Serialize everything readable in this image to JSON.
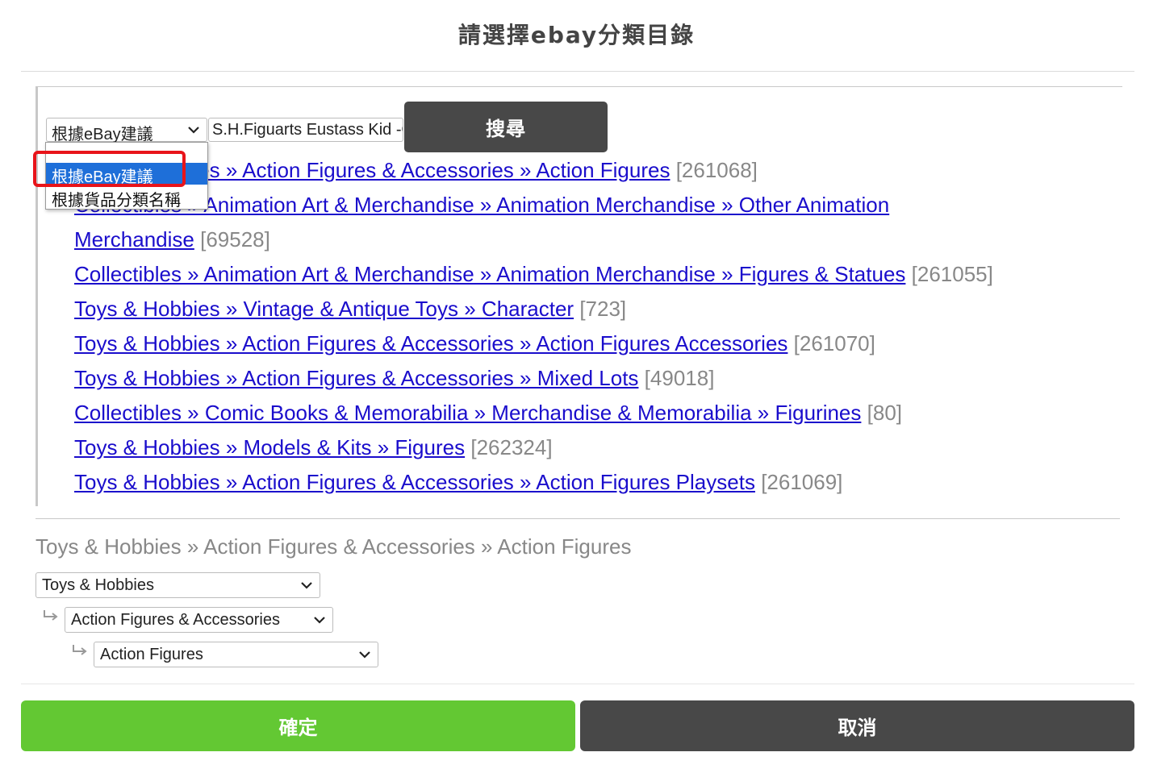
{
  "dialog": {
    "title": "請選擇ebay分類目錄",
    "confirm_label": "確定",
    "cancel_label": "取消"
  },
  "search": {
    "mode_selected": "根據eBay建議",
    "mode_options": [
      "根據eBay建議",
      "根據貨品分類名稱"
    ],
    "keyword_value": "S.H.Figuarts Eustass Kid -O",
    "button_label": "搜尋"
  },
  "results": [
    {
      "path": "Toys & Hobbies » Action Figures & Accessories » Action Figures",
      "count": "[261068]"
    },
    {
      "path": "Collectibles » Animation Art & Merchandise » Animation Merchandise » Other Animation",
      "path_cont": "Merchandise",
      "count": "[69528]"
    },
    {
      "path": "Collectibles » Animation Art & Merchandise » Animation Merchandise » Figures & Statues",
      "count": "[261055]"
    },
    {
      "path": "Toys & Hobbies » Vintage & Antique Toys » Character",
      "count": "[723]"
    },
    {
      "path": "Toys & Hobbies » Action Figures & Accessories » Action Figures Accessories",
      "count": "[261070]"
    },
    {
      "path": "Toys & Hobbies » Action Figures & Accessories » Mixed Lots",
      "count": "[49018]"
    },
    {
      "path": "Collectibles » Comic Books & Memorabilia » Merchandise & Memorabilia » Figurines",
      "count": "[80]"
    },
    {
      "path": "Toys & Hobbies » Models & Kits » Figures",
      "count": "[262324]"
    },
    {
      "path": "Toys & Hobbies » Action Figures & Accessories » Action Figures Playsets",
      "count": "[261069]"
    }
  ],
  "selected_category": {
    "breadcrumb": "Toys & Hobbies » Action Figures & Accessories » Action Figures",
    "level1": "Toys & Hobbies",
    "level2": "Action Figures & Accessories",
    "level3": "Action Figures"
  },
  "colors": {
    "link": "#1a0dcc",
    "confirm": "#63c833",
    "dark_button": "#484848",
    "highlight": "#e8141a",
    "selected_option": "#1e6fd9"
  }
}
